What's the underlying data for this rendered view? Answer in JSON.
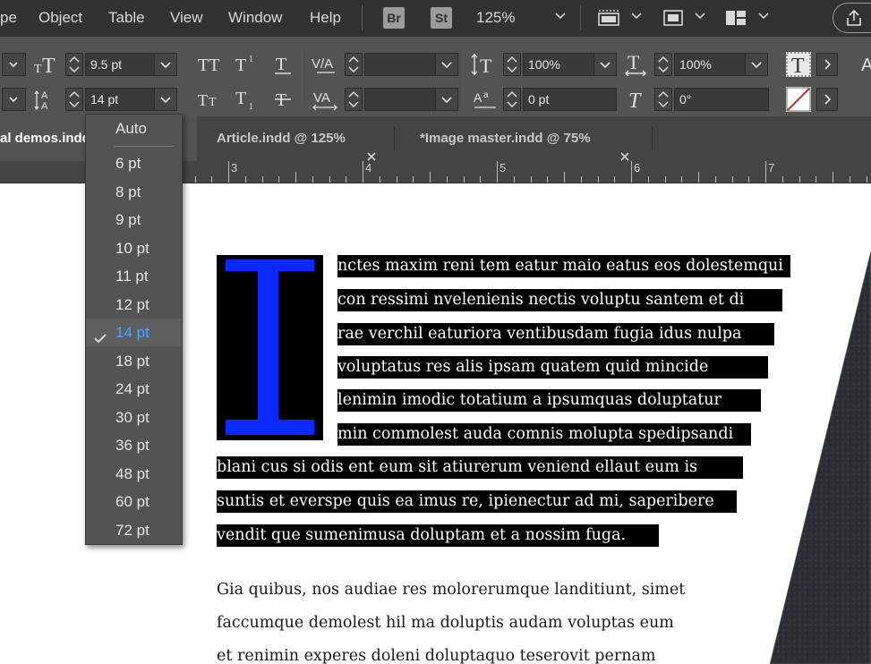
{
  "menubar": {
    "items": [
      "pe",
      "Object",
      "Table",
      "View",
      "Window",
      "Help"
    ],
    "bridge_label": "Br",
    "stock_label": "St",
    "zoom": "125%"
  },
  "control_panel": {
    "font_size": "9.5 pt",
    "leading": "14 pt",
    "kerning": "",
    "tracking": "",
    "vertical_scale": "100%",
    "horizontal_scale": "100%",
    "baseline_shift": "0 pt",
    "skew": "0°"
  },
  "tabs": [
    {
      "label": "al demos.indd",
      "active": true
    },
    {
      "label": "Article.indd @ 125%",
      "active": false
    },
    {
      "label": "*Image master.indd @ 75%",
      "active": false
    }
  ],
  "ruler": {
    "marks": [
      "3",
      "4",
      "5",
      "6",
      "7"
    ]
  },
  "leading_dropdown": {
    "options": [
      "Auto",
      "6 pt",
      "8 pt",
      "9 pt",
      "10 pt",
      "11 pt",
      "12 pt",
      "14 pt",
      "18 pt",
      "24 pt",
      "30 pt",
      "36 pt",
      "48 pt",
      "60 pt",
      "72 pt"
    ],
    "selected": "14 pt"
  },
  "document": {
    "drop_cap": "I",
    "selected_lines": [
      "nctes maxim reni tem eatur maio eatus eos dolestemqui",
      "con ressimi nvelenienis nectis voluptu santem et di",
      "rae verchil eaturiora ventibusdam fugia idus nulpa",
      "voluptatus res alis ipsam quatem quid mincide",
      "lenimin imodic totatium a ipsumquas doluptatur",
      "min commolest auda comnis molupta spedipsandi",
      "blani cus si odis ent eum sit atiurerum veniend ellaut eum is",
      "suntis et everspe quis ea imus re, ipienectur ad mi, saperibere",
      "vendit que sumenimusa doluptam et a nossim fuga."
    ],
    "body_lines": [
      "Gia quibus, nos audiae res molorerumque landitiunt, simet",
      "faccumque demolest hil ma doluptis audam voluptas eum",
      "et renimin experes doleni doluptaquo teserovit pernam"
    ]
  },
  "colors": {
    "drop_cap": "#0a28ff",
    "selected_option": "#4aa3ff",
    "highlight": "#000000"
  }
}
